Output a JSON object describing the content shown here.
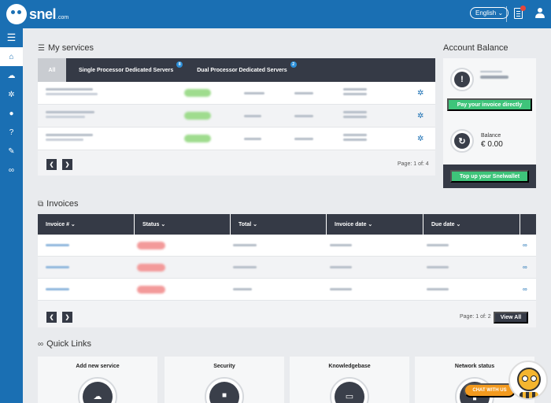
{
  "header": {
    "logo_text": "snel",
    "logo_domain": ".com",
    "language": "English ⌄"
  },
  "sidebar": {
    "items": [
      {
        "icon": "menu-icon",
        "glyph": "☰"
      },
      {
        "icon": "home-icon",
        "glyph": "⌂"
      },
      {
        "icon": "cloud-icon",
        "glyph": "☁"
      },
      {
        "icon": "gear-icon",
        "glyph": "✲"
      },
      {
        "icon": "user-icon",
        "glyph": "●"
      },
      {
        "icon": "help-icon",
        "glyph": "?"
      },
      {
        "icon": "pencil-icon",
        "glyph": "✎"
      },
      {
        "icon": "link-icon",
        "glyph": "∞"
      }
    ]
  },
  "services": {
    "title": "My services",
    "tabs": [
      {
        "label": "All"
      },
      {
        "label": "Single Processor Dedicated Servers",
        "badge": "8"
      },
      {
        "label": "Dual Processor Dedicated Servers",
        "badge": "2"
      }
    ],
    "pagination": "Page: 1 of: 4"
  },
  "account": {
    "title": "Account Balance",
    "pay_button": "Pay your invoice directly",
    "balance_label": "Balance",
    "balance_value": "€ 0.00",
    "topup_button": "Top up your Snelwallet"
  },
  "invoices": {
    "title": "Invoices",
    "columns": [
      "Invoice # ⌄",
      "Status ⌄",
      "Total ⌄",
      "Invoice date ⌄",
      "Due date ⌄"
    ],
    "pagination": "Page: 1 of: 2",
    "view_all": "View All"
  },
  "quick_links": {
    "title": "Quick Links",
    "cards": [
      {
        "label": "Add new service",
        "icon": "cloud-icon",
        "glyph": "☁"
      },
      {
        "label": "Security",
        "icon": "lock-icon",
        "glyph": "🔒"
      },
      {
        "label": "Knowledgebase",
        "icon": "box-icon",
        "glyph": "▭"
      },
      {
        "label": "Network status",
        "icon": "bars-icon",
        "glyph": "▮"
      }
    ]
  },
  "chat": {
    "label": "CHAT WITH US"
  }
}
